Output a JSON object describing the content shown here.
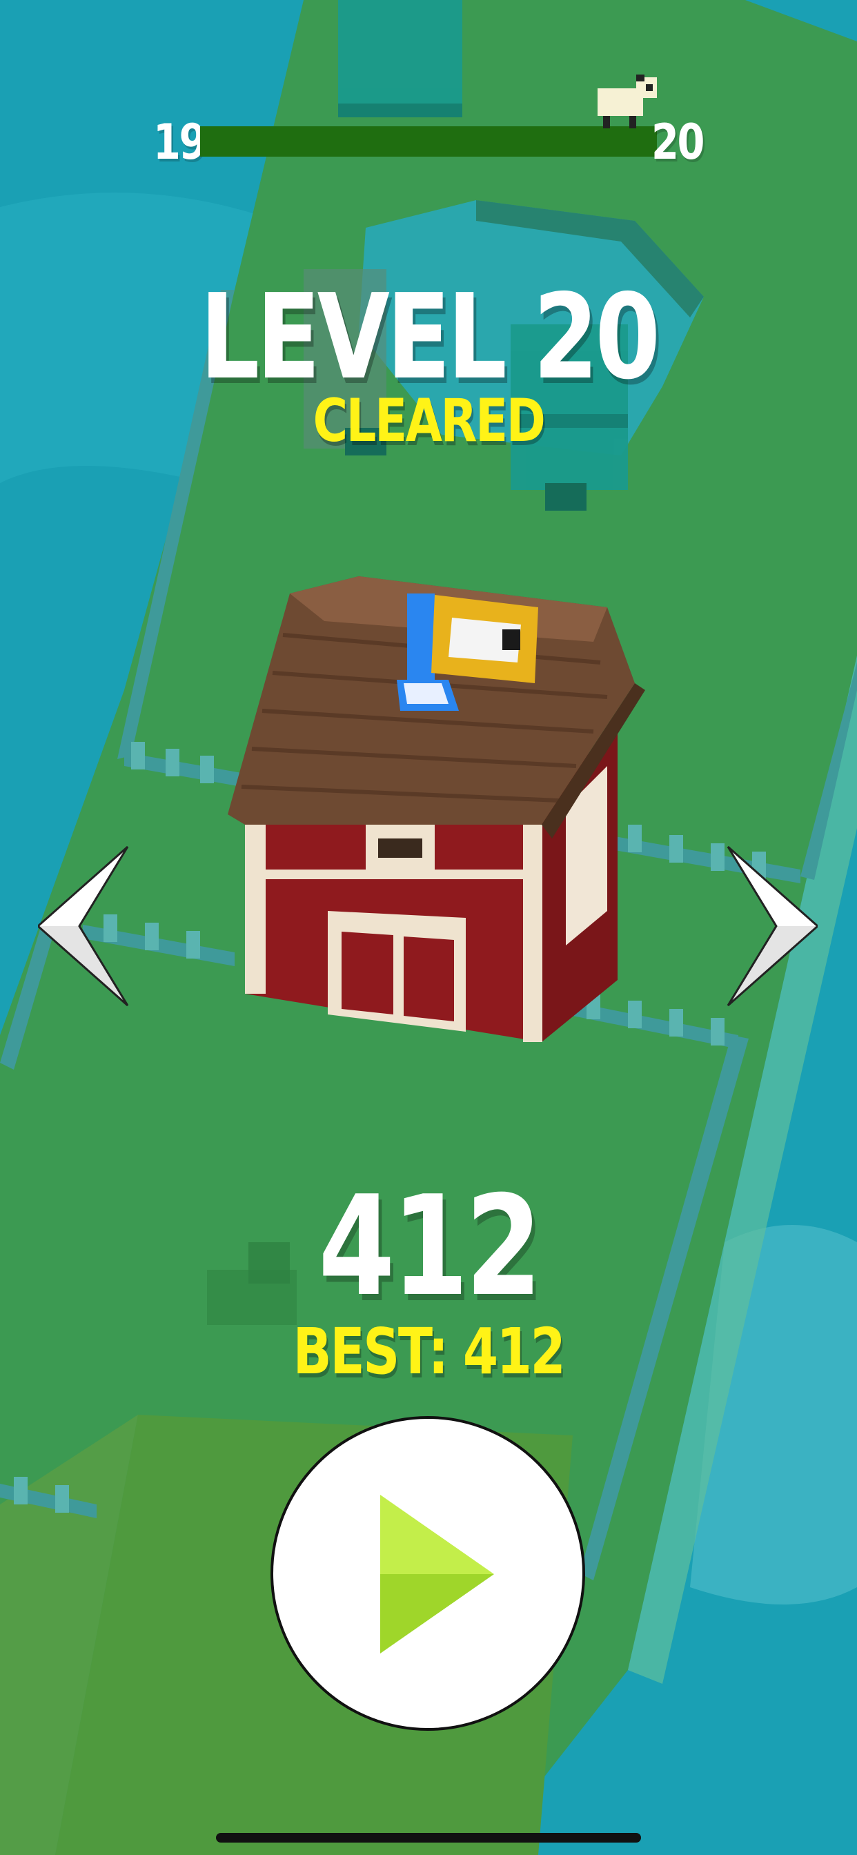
{
  "hud": {
    "current_level": "19",
    "next_level": "20",
    "progress_fraction": 1.0
  },
  "result": {
    "title": "LEVEL 20",
    "status": "CLEARED"
  },
  "score": {
    "value": "412",
    "best_label": "BEST: 412"
  },
  "colors": {
    "water": "#1aa0b4",
    "grass": "#3c9a52",
    "progress_bar": "#1f6e10",
    "title_text": "#ffffff",
    "highlight_text": "#fff317",
    "barn_red": "#8f1a1e",
    "roof_brown": "#6e4a32",
    "play_icon": "#9fd62a"
  },
  "icons": {
    "prev": "chevron-left-icon",
    "next": "chevron-right-icon",
    "play": "play-icon",
    "sheep": "sheep-icon"
  }
}
